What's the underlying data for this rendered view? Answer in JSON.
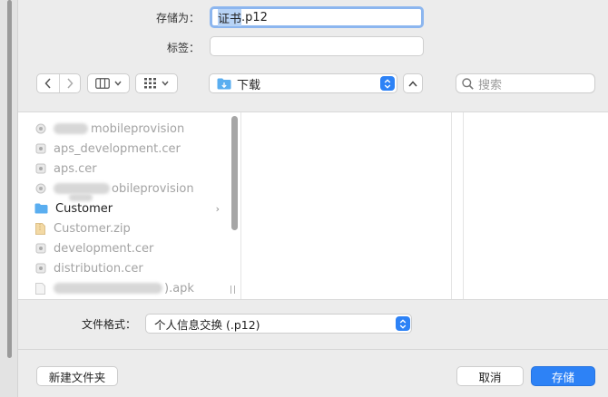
{
  "save_as": {
    "label": "存储为：",
    "value_selected": "证书",
    "value_rest": ".p12"
  },
  "tags": {
    "label": "标签：",
    "value": ""
  },
  "toolbar": {
    "location": "下载",
    "search_placeholder": "搜索"
  },
  "files": [
    {
      "name_visible": "mobileprovision",
      "blurred": true,
      "icon": "provision-icon",
      "active": false
    },
    {
      "name": "aps_development.cer",
      "icon": "certificate-icon",
      "active": false
    },
    {
      "name": "aps.cer",
      "icon": "certificate-icon",
      "active": false
    },
    {
      "name_visible": "obileprovision",
      "blurred": true,
      "icon": "provision-icon",
      "active": false
    },
    {
      "name": "Customer",
      "icon": "folder-icon",
      "active": true,
      "chevron": "›"
    },
    {
      "name": "Customer.zip",
      "icon": "zip-icon",
      "active": false
    },
    {
      "name": "development.cer",
      "icon": "certificate-icon",
      "active": false
    },
    {
      "name": "distribution.cer",
      "icon": "certificate-icon",
      "active": false
    },
    {
      "name_visible": ").apk",
      "blurred": true,
      "icon": "document-icon",
      "active": false
    }
  ],
  "format": {
    "label": "文件格式：",
    "value": "个人信息交换 (.p12)"
  },
  "buttons": {
    "new_folder": "新建文件夹",
    "cancel": "取消",
    "save": "存储"
  },
  "colors": {
    "accent": "#2d82f6",
    "selection": "#b7d3f6",
    "folder": "#5aaef0"
  }
}
